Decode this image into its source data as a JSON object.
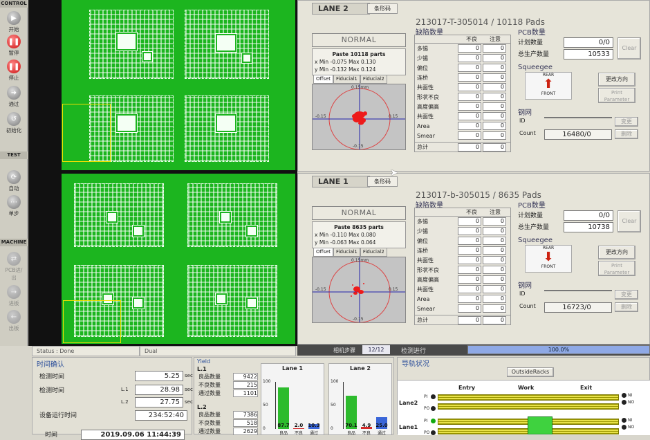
{
  "toolbar": {
    "control_label": "CONTROL",
    "test_label": "TEST",
    "machine_label": "MACHINE",
    "buttons": [
      {
        "label": "开始",
        "icon": "start-icon"
      },
      {
        "label": "暂停",
        "icon": "pause-icon"
      },
      {
        "label": "停止",
        "icon": "stop-icon"
      },
      {
        "label": "通过",
        "icon": "pass-icon"
      },
      {
        "label": "初始化",
        "icon": "initialize-icon"
      },
      {
        "label": "自动",
        "icon": "auto-icon"
      },
      {
        "label": "单步",
        "icon": "step-icon"
      },
      {
        "label": "PCB进/出",
        "icon": "pcb-inout-icon"
      },
      {
        "label": "进板",
        "icon": "board-in-icon"
      },
      {
        "label": "出板",
        "icon": "board-out-icon"
      }
    ]
  },
  "lanes": [
    {
      "tab": "LANE 2",
      "barcode_tab": "条形码",
      "program": "213017-T-305014 / 10118 Pads",
      "status": "NORMAL",
      "paste_title": "Paste 10118 parts",
      "x_stats": "x Min -0.075 Max 0.130",
      "y_stats": "y Min -0.132 Max 0.124",
      "offset_tabs": [
        "Offset",
        "Fiducial1",
        "Fiducial2"
      ],
      "scope_labels": {
        "top": "0.15mm",
        "left": "-0.15",
        "right": "0.15",
        "bottom": "-0.15"
      },
      "defect_title": "缺陷数量",
      "defect_cols": [
        "不良",
        "注意"
      ],
      "defects": [
        {
          "name": "多锡",
          "bad": "0",
          "warn": "0"
        },
        {
          "name": "少锡",
          "bad": "0",
          "warn": "0"
        },
        {
          "name": "偏位",
          "bad": "0",
          "warn": "0"
        },
        {
          "name": "连桥",
          "bad": "0",
          "warn": "0"
        },
        {
          "name": "共面性",
          "bad": "0",
          "warn": "0"
        },
        {
          "name": "形状不良",
          "bad": "0",
          "warn": "0"
        },
        {
          "name": "高度偏高",
          "bad": "0",
          "warn": "0"
        },
        {
          "name": "共面性",
          "bad": "0",
          "warn": "0"
        },
        {
          "name": "Area",
          "bad": "0",
          "warn": "0"
        },
        {
          "name": "Smear",
          "bad": "0",
          "warn": "0"
        }
      ],
      "total_label": "总计",
      "total_bad": "0",
      "total_warn": "0",
      "pcb_title": "PCB数量",
      "planned_label": "计划数量",
      "planned_value": "0/0",
      "produced_label": "总生产数量",
      "produced_value": "10533",
      "clear_label": "Clear",
      "squeegee_title": "Squeegee",
      "squeegee_rear": "REAR",
      "squeegee_front": "FRONT",
      "change_dir_label": "更改方向",
      "print_param_label": "Print Parameter",
      "stencil_title": "钢网",
      "id_label": "ID",
      "count_label": "Count",
      "count_value": "16480/0",
      "change_label": "变更",
      "delete_label": "删除"
    },
    {
      "tab": "LANE 1",
      "barcode_tab": "条形码",
      "program": "213017-b-305015 / 8635 Pads",
      "status": "NORMAL",
      "paste_title": "Paste 8635 parts",
      "x_stats": "x Min -0.110 Max 0.080",
      "y_stats": "y Min -0.063 Max 0.064",
      "offset_tabs": [
        "Offset",
        "Fiducial1",
        "Fiducial2"
      ],
      "scope_labels": {
        "top": "0.15mm",
        "left": "-0.15",
        "right": "0.15",
        "bottom": "-0.15"
      },
      "defect_title": "缺陷数量",
      "defect_cols": [
        "不良",
        "注意"
      ],
      "defects": [
        {
          "name": "多锡",
          "bad": "0",
          "warn": "0"
        },
        {
          "name": "少锡",
          "bad": "0",
          "warn": "0"
        },
        {
          "name": "偏位",
          "bad": "0",
          "warn": "0"
        },
        {
          "name": "连桥",
          "bad": "0",
          "warn": "0"
        },
        {
          "name": "共面性",
          "bad": "0",
          "warn": "0"
        },
        {
          "name": "形状不良",
          "bad": "0",
          "warn": "0"
        },
        {
          "name": "高度偏高",
          "bad": "0",
          "warn": "0"
        },
        {
          "name": "共面性",
          "bad": "0",
          "warn": "0"
        },
        {
          "name": "Area",
          "bad": "0",
          "warn": "0"
        },
        {
          "name": "Smear",
          "bad": "0",
          "warn": "0"
        }
      ],
      "total_label": "总计",
      "total_bad": "0",
      "total_warn": "0",
      "pcb_title": "PCB数量",
      "planned_label": "计划数量",
      "planned_value": "0/0",
      "produced_label": "总生产数量",
      "produced_value": "10738",
      "clear_label": "Clear",
      "squeegee_title": "Squeegee",
      "squeegee_rear": "REAR",
      "squeegee_front": "FRONT",
      "change_dir_label": "更改方向",
      "print_param_label": "Print Parameter",
      "stencil_title": "钢网",
      "id_label": "ID",
      "count_label": "Count",
      "count_value": "16723/0",
      "change_label": "变更",
      "delete_label": "删除"
    }
  ],
  "status": {
    "status_text": "Status : Done",
    "mode": "Dual",
    "step_label": "相机步骤",
    "step_value": "12/12",
    "progress_label": "检测进行",
    "progress_text": "100.0%",
    "progress_fraction": 1.0
  },
  "time": {
    "title": "时间确认",
    "rows": [
      {
        "label": "检测时间",
        "sub": "",
        "value": "5.25",
        "unit": "sec"
      },
      {
        "label": "检测时间",
        "sub": "L.1",
        "value": "28.98",
        "unit": "sec"
      },
      {
        "label": "",
        "sub": "L.2",
        "value": "27.75",
        "unit": "sec"
      },
      {
        "label": "设备运行时间",
        "sub": "",
        "value": "234:52:40",
        "unit": ""
      }
    ],
    "bottom_label": "时间",
    "bottom_value": "2019.09.06  11:44:39"
  },
  "yield": {
    "title": "Yield",
    "l1_label": "L.1",
    "l2_label": "L.2",
    "l1_rows": [
      {
        "label": "良品数量",
        "value": "9422"
      },
      {
        "label": "不良数量",
        "value": "215"
      },
      {
        "label": "通过数量",
        "value": "1101"
      }
    ],
    "l2_rows": [
      {
        "label": "良品数量",
        "value": "7386"
      },
      {
        "label": "不良数量",
        "value": "518"
      },
      {
        "label": "通过数量",
        "value": "2629"
      }
    ]
  },
  "chart_data": [
    {
      "type": "bar",
      "title": "Lane 1",
      "categories": [
        "良品",
        "不良",
        "通过"
      ],
      "values": [
        87.7,
        2.0,
        10.3
      ],
      "value_labels": [
        "87.7",
        "2.0",
        "10.3"
      ],
      "ylim": [
        0,
        100
      ],
      "yticks": [
        "100",
        "50",
        "0"
      ],
      "colors": [
        "#2dbb2d",
        "#d42a2a",
        "#3a66d8"
      ]
    },
    {
      "type": "bar",
      "title": "Lane 2",
      "categories": [
        "良品",
        "不良",
        "通过"
      ],
      "values": [
        70.1,
        4.9,
        25.0
      ],
      "value_labels": [
        "70.1",
        "4.9",
        "25.0"
      ],
      "ylim": [
        0,
        100
      ],
      "yticks": [
        "100",
        "50",
        "0"
      ],
      "colors": [
        "#2dbb2d",
        "#d42a2a",
        "#3a66d8"
      ]
    }
  ],
  "nav": {
    "title": "导轨状况",
    "outside_racks": "OutsideRacks",
    "cols": [
      "Entry",
      "Work",
      "Exit"
    ],
    "lane2_label": "Lane2",
    "lane1_label": "Lane1",
    "pi": "PI",
    "po": "PO",
    "ni": "NI",
    "no": "NO"
  }
}
